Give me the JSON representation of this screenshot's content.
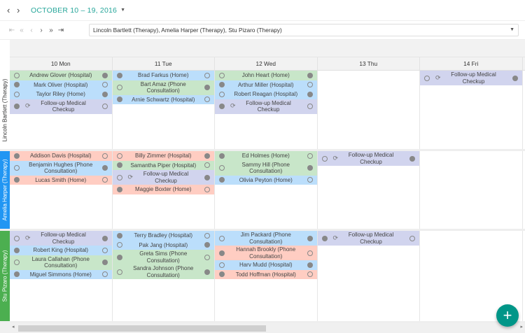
{
  "header": {
    "prev": "‹",
    "next": "›",
    "range": "OCTOBER 10 – 19, 2016"
  },
  "pager": {
    "first": "⇤",
    "prev_page": "«",
    "prev": "‹",
    "next": "›",
    "next_page": "»",
    "last": "⇥"
  },
  "resource_select": {
    "value": "Lincoln Bartlett (Therapy), Amelia Harper (Therapy), Stu Pizaro (Therapy)"
  },
  "days": [
    "10 Mon",
    "11 Tue",
    "12 Wed",
    "13 Thu",
    "14 Fri"
  ],
  "colors": {
    "green": "#c8e6c9",
    "blue": "#bbdefb",
    "purple": "#d1d4ee",
    "red": "#ffcdc2",
    "accent": "#26a69a",
    "fab": "#009688"
  },
  "groups": [
    {
      "label": "Lincoln Bartlett (Therapy)",
      "color": "#ffffff",
      "text_color": "#333333",
      "days": [
        [
          {
            "text": "Andrew Glover (Hospital)",
            "color": "green"
          },
          {
            "text": "Mark Oliver (Hospital)",
            "color": "blue"
          },
          {
            "text": "Taylor Riley (Home)",
            "color": "blue"
          },
          {
            "text": "Follow-up Medical Checkup",
            "color": "purple",
            "recurring": true
          }
        ],
        [
          {
            "text": "Brad Farkus (Home)",
            "color": "blue"
          },
          {
            "text": "Bart Amaz (Phone Consultation)",
            "color": "green"
          },
          {
            "text": "Arnie Schwartz (Hospital)",
            "color": "blue"
          }
        ],
        [
          {
            "text": "John Heart (Home)",
            "color": "green"
          },
          {
            "text": "Arthur Miller (Hospital)",
            "color": "blue"
          },
          {
            "text": "Robert Reagan (Hospital)",
            "color": "blue"
          },
          {
            "text": "Follow-up Medical Checkup",
            "color": "purple",
            "recurring": true
          }
        ],
        [],
        [
          {
            "text": "Follow-up Medical Checkup",
            "color": "purple",
            "recurring": true
          }
        ]
      ]
    },
    {
      "label": "Amelia Harper (Therapy)",
      "color": "#2196f3",
      "text_color": "#ffffff",
      "days": [
        [
          {
            "text": "Addison Davis (Hospital)",
            "color": "red"
          },
          {
            "text": "Benjamin Hughes (Phone Consultation)",
            "color": "blue"
          },
          {
            "text": "Lucas Smith (Home)",
            "color": "red"
          }
        ],
        [
          {
            "text": "Billy Zimmer (Hospital)",
            "color": "red"
          },
          {
            "text": "Samantha Piper (Hospital)",
            "color": "green"
          },
          {
            "text": "Follow-up Medical Checkup",
            "color": "purple",
            "recurring": true
          },
          {
            "text": "Maggie Boxter (Home)",
            "color": "red"
          }
        ],
        [
          {
            "text": "Ed Holmes (Home)",
            "color": "green"
          },
          {
            "text": "Sammy Hill (Phone Consultation)",
            "color": "green"
          },
          {
            "text": "Olivia Peyton (Home)",
            "color": "blue"
          }
        ],
        [
          {
            "text": "Follow-up Medical Checkup",
            "color": "purple",
            "recurring": true
          }
        ],
        []
      ]
    },
    {
      "label": "Stu Pizaro (Therapy)",
      "color": "#4caf50",
      "text_color": "#ffffff",
      "days": [
        [
          {
            "text": "Follow-up Medical Checkup",
            "color": "purple",
            "recurring": true
          },
          {
            "text": "Robert King (Hospital)",
            "color": "blue"
          },
          {
            "text": "Laura Callahan (Phone Consultation)",
            "color": "green"
          },
          {
            "text": "Miguel Simmons (Home)",
            "color": "blue"
          }
        ],
        [
          {
            "text": "Terry Bradley (Hospital)",
            "color": "blue"
          },
          {
            "text": "Pak Jang (Hospital)",
            "color": "blue"
          },
          {
            "text": "Greta Sims (Phone Consultation)",
            "color": "green"
          },
          {
            "text": "Sandra Johnson (Phone Consultation)",
            "color": "green"
          }
        ],
        [
          {
            "text": "Jim Packard (Phone Consultation)",
            "color": "blue"
          },
          {
            "text": "Hannah Brookly (Phone Consultation)",
            "color": "red"
          },
          {
            "text": "Harv Mudd (Hospital)",
            "color": "blue"
          },
          {
            "text": "Todd Hoffman (Hospital)",
            "color": "red"
          }
        ],
        [
          {
            "text": "Follow-up Medical Checkup",
            "color": "purple",
            "recurring": true
          }
        ],
        []
      ]
    }
  ],
  "fab": {
    "label": "+"
  }
}
